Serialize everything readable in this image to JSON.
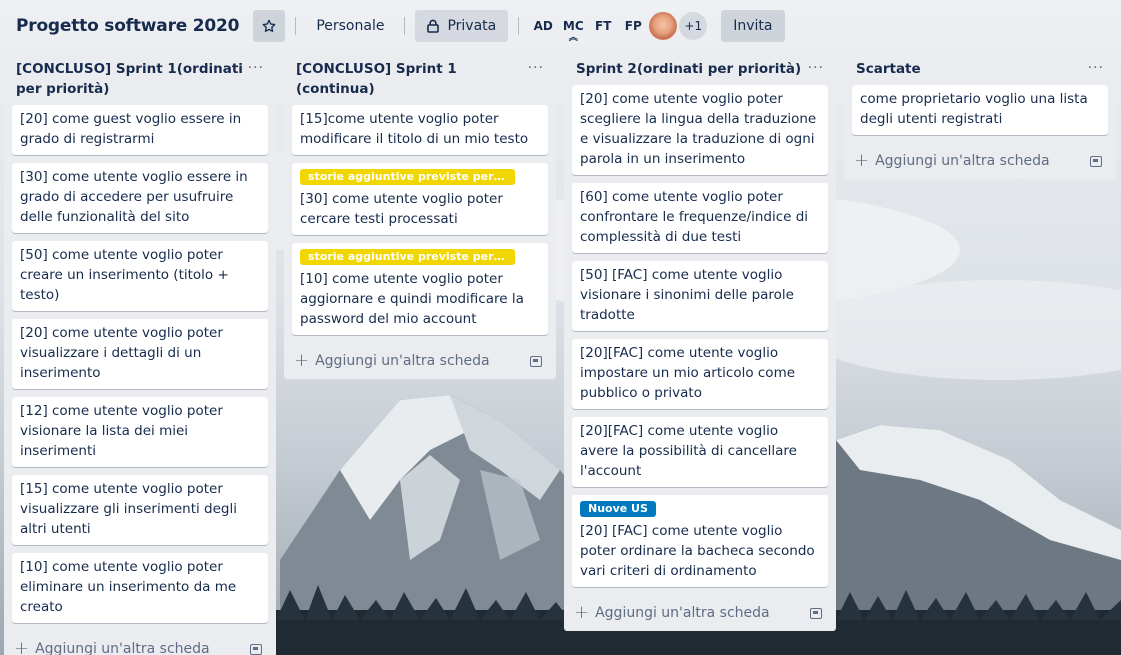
{
  "board": {
    "title": "Progetto software 2020",
    "team_label": "Personale",
    "visibility_label": "Privata",
    "invite_label": "Invita",
    "members": [
      "AD",
      "MC",
      "FT",
      "FP"
    ],
    "members_more": "+1"
  },
  "add_card_label": "Aggiungi un'altra scheda",
  "list_menu_glyph": "···",
  "lists": [
    {
      "title": "[CONCLUSO] Sprint 1(ordinati per priorità)",
      "cards": [
        {
          "text": "[20] come guest voglio essere in grado di registrarmi"
        },
        {
          "text": "[30] come utente voglio essere in grado di accedere per usufruire delle funzionalità del sito"
        },
        {
          "text": "[50] come utente voglio poter creare un inserimento (titolo + testo)"
        },
        {
          "text": "[20] come utente voglio poter visualizzare i dettagli di un inserimento"
        },
        {
          "text": "[12] come utente voglio poter visionare la lista dei miei inserimenti"
        },
        {
          "text": "[15] come utente voglio poter visualizzare gli inserimenti degli altri utenti"
        },
        {
          "text": "[10] come utente voglio poter eliminare un inserimento da me creato"
        }
      ]
    },
    {
      "title": "[CONCLUSO] Sprint 1 (continua)",
      "cards": [
        {
          "text": "[15]come utente voglio poter modificare il titolo di un mio testo"
        },
        {
          "label": "storie aggiuntive previste per lo ...",
          "label_color": "#f2d600",
          "text": "[30] come utente voglio poter cercare testi processati"
        },
        {
          "label": "storie aggiuntive previste per lo ...",
          "label_color": "#f2d600",
          "text": "[10] come utente voglio poter aggiornare e quindi modificare la password del mio account"
        }
      ]
    },
    {
      "title": "Sprint 2(ordinati per priorità)",
      "cards": [
        {
          "text": "[20] come utente voglio poter scegliere la lingua della traduzione e visualizzare la traduzione di ogni parola in un inserimento"
        },
        {
          "text": "[60] come utente voglio poter confrontare le frequenze/indice di complessità di due testi"
        },
        {
          "text": "[50] [FAC] come utente voglio visionare i sinonimi delle parole tradotte"
        },
        {
          "text": "[20][FAC] come utente voglio impostare un mio articolo come pubblico o privato"
        },
        {
          "text": "[20][FAC] come utente voglio avere la possibilità di cancellare l'account"
        },
        {
          "label": "Nuove US",
          "label_color": "#0079bf",
          "text": "[20] [FAC] come utente voglio poter ordinare la bacheca secondo vari criteri di ordinamento"
        }
      ]
    },
    {
      "title": "Scartate",
      "cards": [
        {
          "text": "come proprietario voglio una lista degli utenti registrati"
        }
      ]
    }
  ]
}
